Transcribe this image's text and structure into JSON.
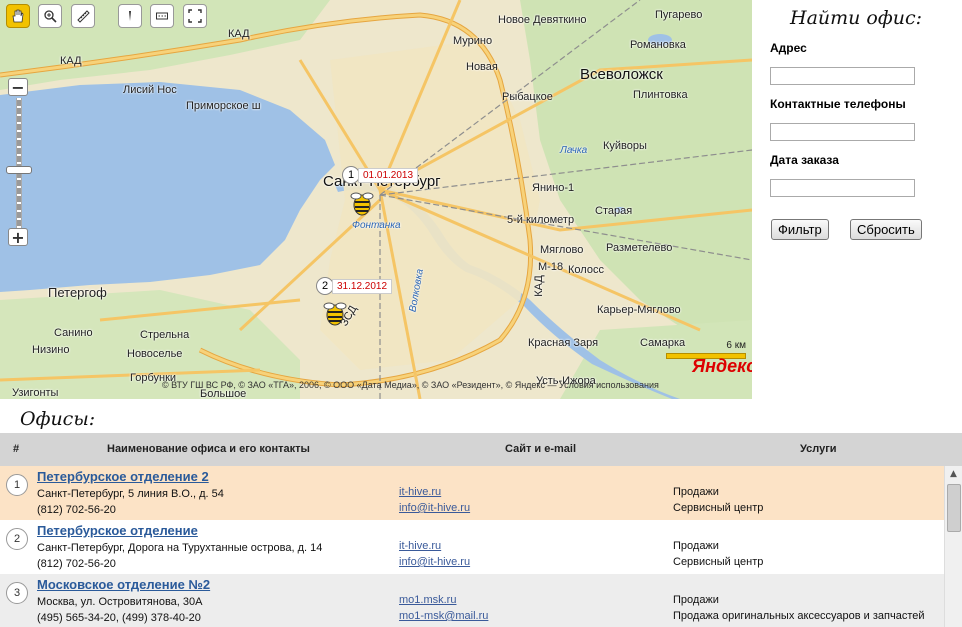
{
  "map": {
    "toolbar": [
      {
        "name": "hand-tool-button",
        "icon": "hand-icon"
      },
      {
        "name": "magnifier-tool-button",
        "icon": "magnifier-icon"
      },
      {
        "name": "ruler-tool-button",
        "icon": "ruler-icon"
      },
      {
        "name": "cursor-tool-button",
        "icon": "cursor-icon"
      },
      {
        "name": "layers-tool-button",
        "icon": "layers-icon"
      },
      {
        "name": "fullscreen-tool-button",
        "icon": "fullscreen-icon"
      }
    ],
    "zoom_plus": "+",
    "zoom_minus": "−",
    "labels": {
      "spb": "Санкт-Петербург",
      "vsevolozhsk": "Всеволожск",
      "murino": "Мурино",
      "novaya": "Новая",
      "rybackoe": "Рыбацкое",
      "novoe_devyatkino": "Новое Девяткино",
      "romanovka": "Романовка",
      "pugarevo": "Пугарево",
      "plintovka": "Плинтовка",
      "kuyvory": "Куйворы",
      "yanino": "Янино-1",
      "staraya": "Старая",
      "razmetelevo": "Разметелево",
      "km5": "5-й километр",
      "myaglovo": "Мяглово",
      "koloss": "Колосс",
      "karer": "Карьер-Мяглово",
      "samarka": "Самарка",
      "krasnaya_zarya": "Красная Заря",
      "ust_izhora": "Усть-Ижора",
      "lisiy_nos": "Лисий Нос",
      "primorskoe": "Приморское ш",
      "peterhof": "Петергоф",
      "sanino": "Санино",
      "strelna": "Стрельна",
      "nizino": "Низино",
      "novoselye": "Новоселье",
      "gorbunki": "Горбунки",
      "uzigonty": "Узигонты",
      "bolshoe": "Большое",
      "fontanka": "Фонтанка",
      "volkovka": "Волковка",
      "kad": "КАД",
      "lacka": "Лачка",
      "m18": "М-18",
      "zsd": "ЗСД",
      "yandex_logo": "Яндекс"
    },
    "markers": [
      {
        "num": "1",
        "date": "01.01.2013"
      },
      {
        "num": "2",
        "date": "31.12.2012"
      }
    ],
    "scale_label": "6 км",
    "copyright": "© ВТУ ГШ ВС РФ, © ЗАО «ТГА», 2006, © ООО «Дата Медиа», © ЗАО «Резидент», © Яндекс — Условия использования"
  },
  "filter": {
    "title": "Найти офис:",
    "address_label": "Адрес",
    "address_value": "",
    "phones_label": "Контактные телефоны",
    "phones_value": "",
    "date_label": "Дата заказа",
    "date_value": "",
    "filter_button": "Фильтр",
    "reset_button": "Сбросить"
  },
  "offices": {
    "title": "Офисы:",
    "columns": {
      "num": "#",
      "name": "Наименование офиса и его контакты",
      "site": "Сайт и e-mail",
      "services": "Услуги"
    },
    "rows": [
      {
        "num": "1",
        "name": "Петербурское отделение 2",
        "address": "Санкт-Петербург, 5 линия В.О., д. 54",
        "phone": "(812) 702-56-20",
        "site": "it-hive.ru",
        "email": "info@it-hive.ru",
        "service1": "Продажи",
        "service2": "Сервисный центр",
        "bg": "#fce3c6"
      },
      {
        "num": "2",
        "name": "Петербурское отделение",
        "address": "Санкт-Петербург, Дорога на Турухтанные острова, д. 14",
        "phone": "(812) 702-56-20",
        "site": "it-hive.ru",
        "email": "info@it-hive.ru",
        "service1": "Продажи",
        "service2": "Сервисный центр",
        "bg": "#ffffff"
      },
      {
        "num": "3",
        "name": "Московское отделение №2",
        "address": "Москва, ул. Островитянова, 30А",
        "phone": "(495) 565-34-20, (499) 378-40-20",
        "site": "mo1.msk.ru",
        "email": "mo1-msk@mail.ru",
        "service1": "Продажи",
        "service2": "Продажа оригинальных аксессуаров и запчастей",
        "bg": "#ededed"
      }
    ]
  }
}
